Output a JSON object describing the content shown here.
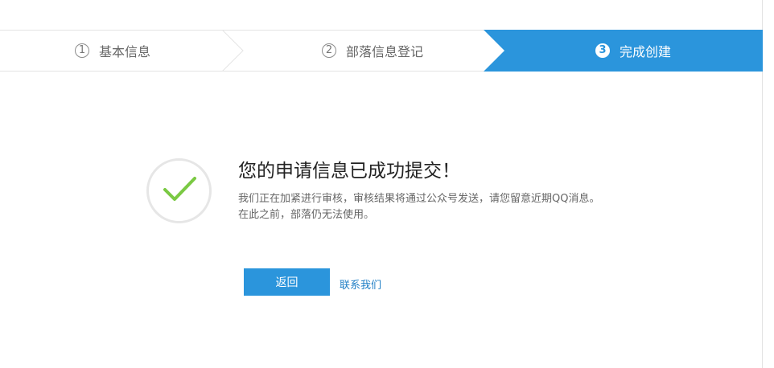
{
  "steps": [
    {
      "number": "1",
      "label": "基本信息",
      "state": "done"
    },
    {
      "number": "2",
      "label": "部落信息登记",
      "state": "done"
    },
    {
      "number": "3",
      "label": "完成创建",
      "state": "active"
    }
  ],
  "result": {
    "icon": "checkmark-icon",
    "title": "您的申请信息已成功提交！",
    "desc_line1": "我们正在加紧进行审核，审核结果将通过公众号发送，请您留意近期QQ消息。",
    "desc_line2": "在此之前，部落仍无法使用。"
  },
  "actions": {
    "back_label": "返回",
    "contact_label": "联系我们"
  },
  "colors": {
    "accent": "#2b95dc",
    "check": "#7ac943",
    "link": "#1f7fc6"
  }
}
